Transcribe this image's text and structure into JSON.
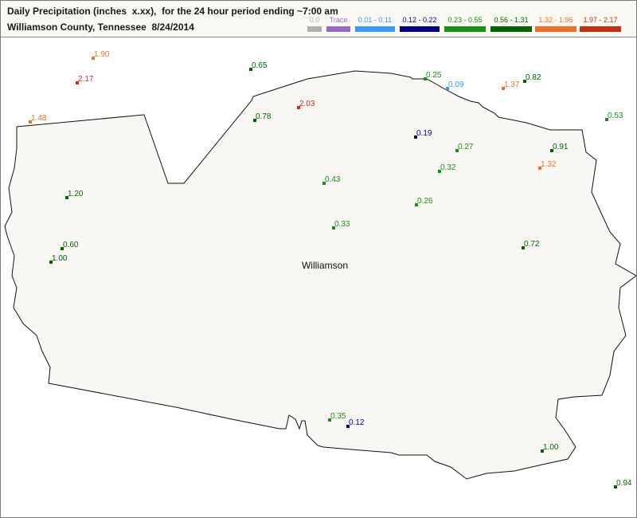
{
  "header": {
    "title": "Daily Precipitation (inches  x.xx),  for the 24 hour period ending ~7:00 am",
    "subtitle": "Williamson County, Tennessee  8/24/2014"
  },
  "legend": [
    {
      "label": "0.0",
      "color": "#b0b0b0"
    },
    {
      "label": "Trace",
      "color": "#9966cc"
    },
    {
      "label": "0.01 - 0.11",
      "color": "#3399ff"
    },
    {
      "label": "0.12 - 0.22",
      "color": "#00008b"
    },
    {
      "label": "0.23 - 0.55",
      "color": "#169216"
    },
    {
      "label": "0.56 - 1.31",
      "color": "#006400"
    },
    {
      "label": "1.32 - 1.96",
      "color": "#f07020"
    },
    {
      "label": "1.97 - 2.17",
      "color": "#c83010"
    }
  ],
  "map": {
    "county_name": "Williamson",
    "county_fill": "#f8f7f4",
    "county_stroke": "#111111"
  },
  "stations": [
    {
      "value": "1.90",
      "category": 6
    },
    {
      "value": "2.17",
      "category": 7
    },
    {
      "value": "0.65",
      "category": 5
    },
    {
      "value": "1.48",
      "category": 6
    },
    {
      "value": "0.25",
      "category": 4
    },
    {
      "value": "0.09",
      "category": 2
    },
    {
      "value": "1.37",
      "category": 6
    },
    {
      "value": "0.82",
      "category": 5
    },
    {
      "value": "2.03",
      "category": 7
    },
    {
      "value": "0.78",
      "category": 5
    },
    {
      "value": "0.53",
      "category": 4
    },
    {
      "value": "0.19",
      "category": 3
    },
    {
      "value": "0.27",
      "category": 4
    },
    {
      "value": "0.91",
      "category": 5
    },
    {
      "value": "0.32",
      "category": 4
    },
    {
      "value": "1.32",
      "category": 6
    },
    {
      "value": "0.43",
      "category": 4
    },
    {
      "value": "1.20",
      "category": 5
    },
    {
      "value": "0.26",
      "category": 4
    },
    {
      "value": "0.33",
      "category": 4
    },
    {
      "value": "0.60",
      "category": 5
    },
    {
      "value": "0.72",
      "category": 5
    },
    {
      "value": "1.00",
      "category": 5
    },
    {
      "value": "0.35",
      "category": 4
    },
    {
      "value": "0.12",
      "category": 3
    },
    {
      "value": "1.00",
      "category": 5
    },
    {
      "value": "0.94",
      "category": 5
    }
  ]
}
